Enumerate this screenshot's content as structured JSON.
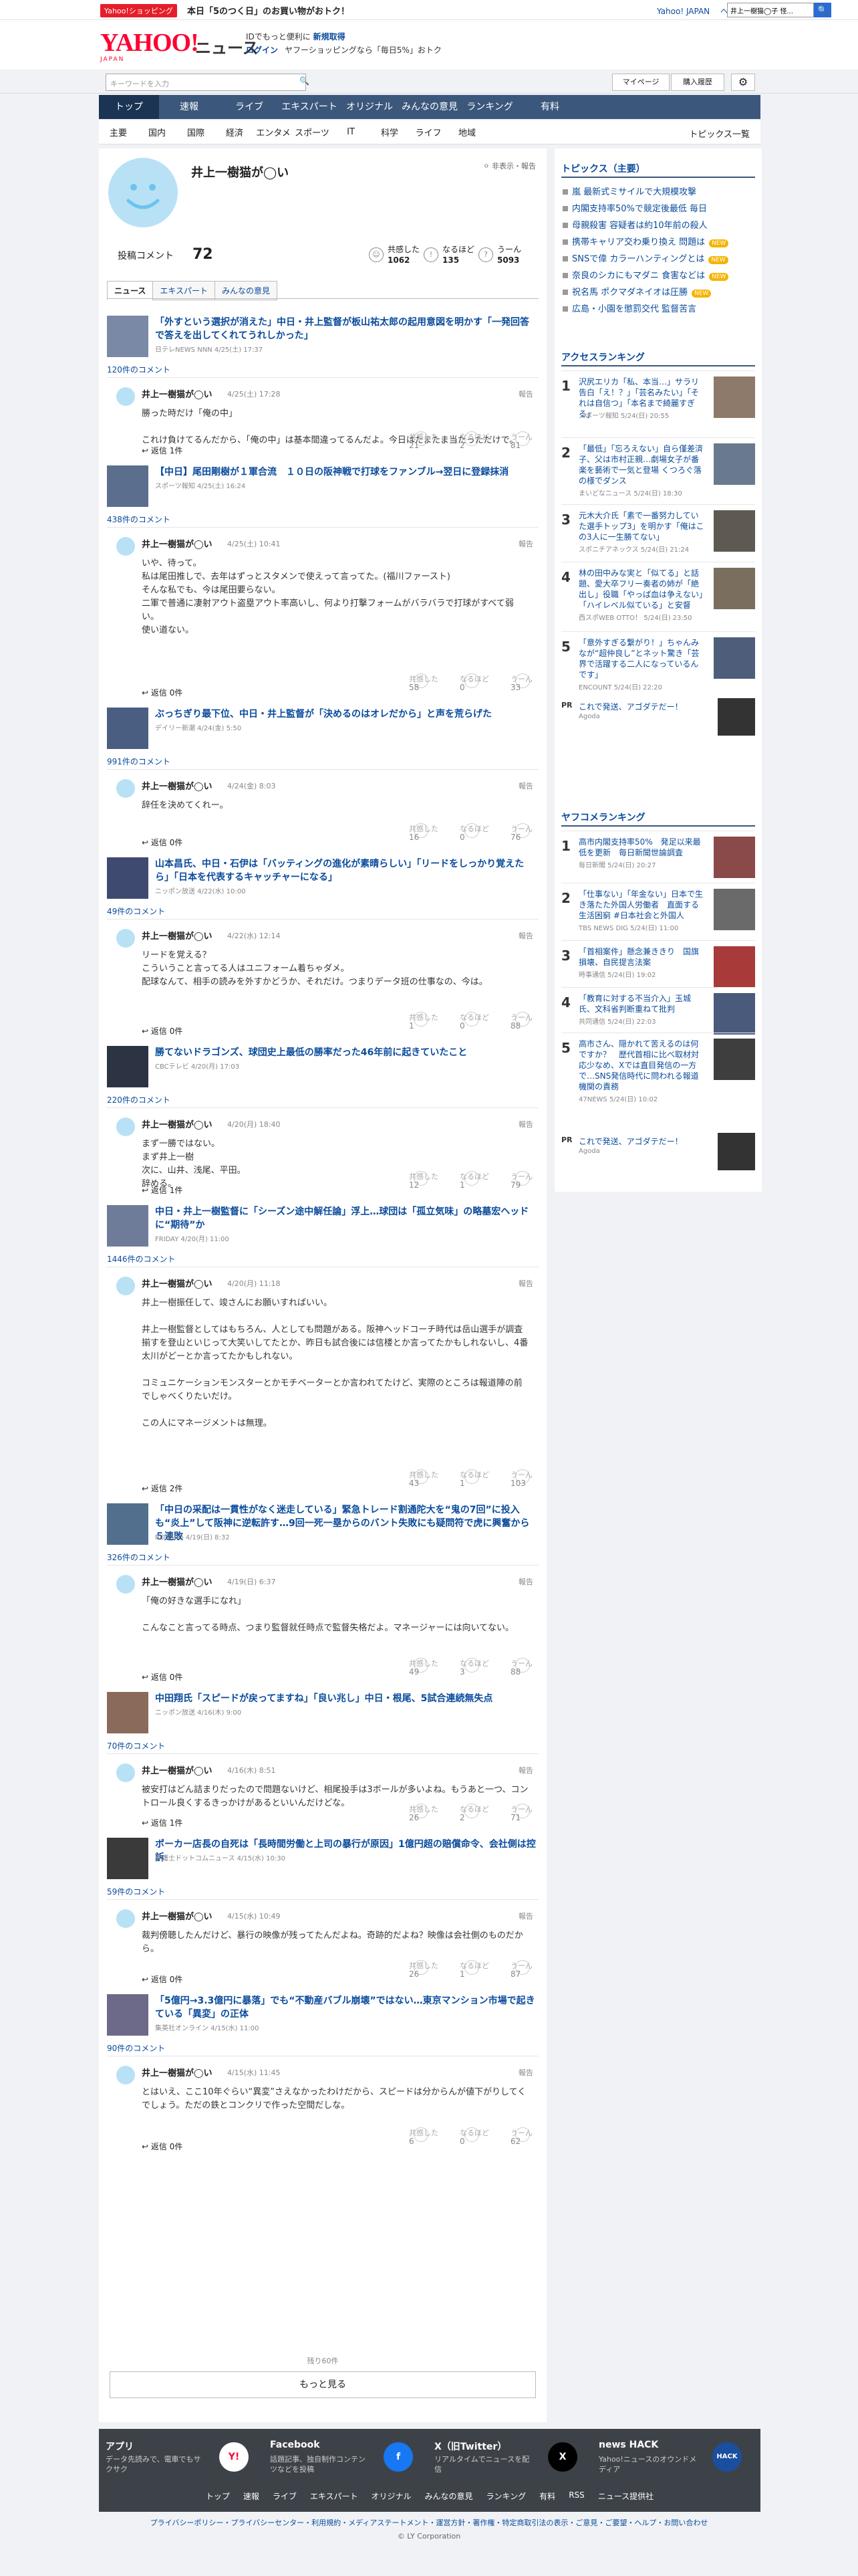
{
  "topbar": {
    "promo_badge": "Yahoo!ショッピング",
    "promo_text": "本日「5のつく日」のお買い物がおトク！",
    "links": [
      "Yahoo! JAPAN",
      "ヘルプ"
    ],
    "search_placeholder": "ウェブ検索",
    "search_value": "井上一樹猫◯子 怪..."
  },
  "header": {
    "logo": "YAHOO!",
    "logo_sub": "JAPAN",
    "service": "ニュース",
    "login_note_pre": "IDでもっと便利に",
    "login_note_link": "新規取得",
    "login_link": "ログイン",
    "login_promo": "ヤフーショッピングなら「毎日5%」おトク"
  },
  "searchbar": {
    "placeholder": "キーワードを入力",
    "mypage": "マイページ",
    "history": "購入履歴"
  },
  "nav1": [
    "トップ",
    "速報",
    "ライブ",
    "エキスパート",
    "オリジナル",
    "みんなの意見",
    "ランキング",
    "有料"
  ],
  "nav2": [
    "主要",
    "国内",
    "国際",
    "経済",
    "エンタメ",
    "スポーツ",
    "IT",
    "科学",
    "ライフ",
    "地域"
  ],
  "nav2_all": "トピックス一覧",
  "profile": {
    "name": "井上一樹猫が◯い",
    "private": "非表示・報告",
    "comments_label": "投稿コメント",
    "comments_count": "72",
    "stats": [
      {
        "label": "共感した",
        "value": "1062"
      },
      {
        "label": "なるほど",
        "value": "135"
      },
      {
        "label": "うーん",
        "value": "5093"
      }
    ]
  },
  "tabs": [
    "ニュース",
    "エキスパート",
    "みんなの意見"
  ],
  "user": {
    "name": "井上一樹猫が◯い",
    "report": "報告",
    "r1": "共感した",
    "r2": "なるほど",
    "r3": "うーん"
  },
  "items": [
    {
      "title": "「外すという選択が消えた」中日・井上監督が板山祐太郎の起用意図を明かす「一発回答で答えを出してくれてうれしかった」",
      "meta": "日テレNEWS NNN 4/25(土) 17:37",
      "comments": "120件のコメント",
      "time": "4/25(土) 17:28",
      "body": "勝った時だけ「俺の中」\n\nこれけ負けてるんだから、「俺の中」は基本間違ってるんだよ。今日はたまたま当たっただけで。",
      "reply": "返信 1件",
      "n1": "21",
      "n2": "2",
      "n3": "81"
    },
    {
      "title": "【中日】尾田剛樹が１軍合流　１０日の阪神戦で打球をファンブル→翌日に登録抹消",
      "meta": "スポーツ報知 4/25(土) 16:24",
      "comments": "438件のコメント",
      "time": "4/25(土) 10:41",
      "body": "いや、待って。\n私は尾田推しで、去年はずっとスタメンで使えって言ってた。(福川ファースト)\nそんな私でも、今は尾田要らない。\n二軍で普通に凄射アウト盗塁アウト率高いし、何より打撃フォームがバラバラで打球がすべて弱い。\n使い道ない。",
      "reply": "返信 0件",
      "n1": "58",
      "n2": "0",
      "n3": "33"
    },
    {
      "title": "ぶっちぎり最下位、中日・井上監督が「決めるのはオレだから」と声を荒らげた",
      "meta": "デイリー新潮 4/24(金) 5:50",
      "comments": "991件のコメント",
      "time": "4/24(金) 8:03",
      "body": "辞任を決めてくれー。",
      "reply": "返信 0件",
      "n1": "16",
      "n2": "0",
      "n3": "76"
    },
    {
      "title": "山本昌氏、中日・石伊は「バッティングの進化が素晴らしい」「リードをしっかり覚えたら」「日本を代表するキャッチャーになる」",
      "meta": "ニッポン放送 4/22(水) 10:00",
      "comments": "49件のコメント",
      "time": "4/22(水) 12:14",
      "body": "リードを覚える？\nこういうこと言ってる人はユニフォーム着ちゃダメ。\n配球なんて、相手の読みを外すかどうか、それだけ。つまりデータ班の仕事なの、今は。",
      "reply": "返信 0件",
      "n1": "1",
      "n2": "0",
      "n3": "88"
    },
    {
      "title": "勝てないドラゴンズ、球団史上最低の勝率だった46年前に起きていたこと",
      "meta": "CBCテレビ 4/20(月) 17:03",
      "comments": "220件のコメント",
      "time": "4/20(月) 18:40",
      "body": "まず一勝ではない。\nまず井上一樹\n次に、山井、浅尾、平田。\n辞める。",
      "reply": "返信 1件",
      "n1": "12",
      "n2": "1",
      "n3": "79"
    },
    {
      "title": "中日・井上一樹監督に「シーズン途中解任論」浮上…球団は「孤立気味」の略墓宏ヘッドに“期待”か",
      "meta": "FRIDAY 4/20(月) 11:00",
      "comments": "1446件のコメント",
      "time": "4/20(月) 11:18",
      "body": "井上一樹振任して、竣さんにお願いすればいい。\n\n井上一樹監督としてはもちろん、人としても問題がある。阪神ヘッドコーチ時代は岳山選手が調査揃すを登山といじって大笑いしてたとか、昨日も試合後には信楼とか言ってたかもしれないし、4番太川がどーとか言ってたかもしれない。\n\nコミュニケーションモンスターとかモチベーターとか言われてたけど、実際のところは報道陣の前でしゃべくりたいだけ。\n\nこの人にマネージメントは無理。",
      "reply": "返信 2件",
      "n1": "43",
      "n2": "1",
      "n3": "103"
    },
    {
      "title": "「中日の采配は一貫性がなく迷走している」緊急トレード割通陀大を“鬼の7回”に投入も“炎上”して阪神に逆転許す…9回一死一塁からのバント失敗にも疑問符で虎に興奮から５連敗",
      "meta": "RONSPO 4/19(日) 8:32",
      "comments": "326件のコメント",
      "time": "4/19(日) 6:37",
      "body": "「俺の好きな選手になれ」\n\nこんなこと言ってる時点、つまり監督就任時点で監督失格だよ。マネージャーには向いてない。",
      "reply": "返信 0件",
      "n1": "49",
      "n2": "3",
      "n3": "88"
    },
    {
      "title": "中田翔氏「スピードが戻ってますね」「良い兆し」中日・根尾、5試合連続無失点",
      "meta": "ニッポン放送 4/16(木) 9:00",
      "comments": "70件のコメント",
      "time": "4/16(木) 8:51",
      "body": "被安打はどん詰まりだったので問題ないけど、相尾投手は3ボールが多いよね。もうあと一つ、コントロール良くするきっかけがあるといいんだけどな。",
      "reply": "返信 1件",
      "n1": "26",
      "n2": "2",
      "n3": "71"
    },
    {
      "title": "ポーカー店長の自死は「長時間労働と上司の暴行が原因」1億円超の賠償命令、会社側は控訴",
      "meta": "弁護士ドットコムニュース 4/15(水) 10:30",
      "comments": "59件のコメント",
      "time": "4/15(水) 10:49",
      "body": "裁判傍聴したんだけど、暴行の映像が残ってたんだよね。奇跡的だよね？映像は会社側のものだから。",
      "reply": "返信 0件",
      "n1": "26",
      "n2": "1",
      "n3": "87"
    },
    {
      "title": "「5億円→3.3億円に暴落」でも“不動産バブル崩壊”ではない…東京マンション市場で起きている「異変」の正体",
      "meta": "集英社オンライン 4/15(水) 11:00",
      "comments": "90件のコメント",
      "time": "4/15(水) 11:45",
      "body": "とはいえ、ここ10年ぐらい“異変”さえなかったわけだから、スピードは分からんが値下がりしてくでしょう。ただの鉄とコンクリで作った空間だしな。",
      "reply": "返信 0件",
      "n1": "6",
      "n2": "0",
      "n3": "62"
    }
  ],
  "more": {
    "note": "残り60件",
    "button": "もっと見る"
  },
  "side": {
    "topics_title": "トピックス（主要）",
    "topics": [
      {
        "t": "嵐 最新式ミサイルで大規模攻撃",
        "new": false
      },
      {
        "t": "内閣支持率50%で競定後最低 毎日",
        "new": false
      },
      {
        "t": "母親殺害 容疑者は約10年前の殺人",
        "new": false
      },
      {
        "t": "携帯キャリア交わ乗り換え 問題は",
        "new": true
      },
      {
        "t": "SNSで偉 カラーハンティングとは",
        "new": true
      },
      {
        "t": "奈良のシカにもマダニ 食害などは",
        "new": true
      },
      {
        "t": "祝名馬 ポクマダネイオは圧勝",
        "new": true
      },
      {
        "t": "広島・小園を懲罰交代 監督苦言",
        "new": false
      }
    ],
    "access_title": "アクセスランキング",
    "access": [
      {
        "n": "1",
        "t": "沢尻エリカ「私、本当…」サラリ告白「え！？」「芸名みたい」「それは自信つ」「本名まで綺麗すぎる」",
        "s": "スポーツ報知 5/24(日) 20:55"
      },
      {
        "n": "2",
        "t": "「最低」「忘ろえない」自ら僅差済子、父は市村正親…劇場女子が番楽を藝術で一気と登場 くつろぐ落の様でダンス",
        "s": "まいどなニュース 5/24(日) 18:30"
      },
      {
        "n": "3",
        "t": "元木大介氏「素で一番努力していた選手トップ3」を明かす「俺はこの3人に一生勝てない」",
        "s": "スポニチアネックス 5/24(日) 21:24"
      },
      {
        "n": "4",
        "t": "林の田中みな実と「似てる」と話題、愛大卒フリー奏者の姉が「絶出し」役職「やっぱ血は争えない」「ハイレベル似ている」と安督",
        "s": "西スポWEB OTTO！ 5/24(日) 23:50"
      },
      {
        "n": "5",
        "t": "「意外すぎる繋がり！」ちゃんみなが“超仲良し”とネット驚き「芸界で活躍する二人になっているんです」",
        "s": "ENCOUNT 5/24(日) 22:20"
      }
    ],
    "pr": {
      "tag": "PR",
      "title": "これで発送、アゴダテだー！",
      "src": "Agoda"
    },
    "yafoco_title": "ヤフコメランキング",
    "yafoco": [
      {
        "n": "1",
        "t": "高市内閣支持率50%　発足以来最低を更新　毎日新聞世論調査",
        "s": "毎日新聞 5/24(日) 20:27"
      },
      {
        "n": "2",
        "t": "「仕事ない」「年金ない」日本で生き落たた外国人労働者　直面する生活困窮 #日本社会と外国人",
        "s": "TBS NEWS DIG 5/24(日) 11:00"
      },
      {
        "n": "3",
        "t": "「首相案件」懸念兼ききり　国旗損壊、自民提言法案",
        "s": "時事通信 5/24(日) 19:02"
      },
      {
        "n": "4",
        "t": "「教育に対する不当介入」玉城氏、文科省判断重ねて批判",
        "s": "共同通信 5/24(日) 22:03"
      },
      {
        "n": "5",
        "t": "高市さん、隠かれて苦えるのは何ですか？　歴代首相に比べ取材対応少なめ、Xでは直目発信の一方で…SNS発信時代に問われる報道機関の責務",
        "s": "47NEWS 5/24(日) 10:02"
      }
    ],
    "pr2": {
      "tag": "PR",
      "title": "これで発送、アゴダテだー！",
      "src": "Agoda"
    }
  },
  "footer": {
    "apps": [
      {
        "t": "アプリ",
        "d": "データ先読みで、電車でもサクサク",
        "ic": "Y!"
      },
      {
        "t": "Facebook",
        "d": "話題記事、独自制作コンテンツなどを投稿",
        "ic": "f"
      },
      {
        "t": "X（旧Twitter）",
        "d": "リアルタイムでニュースを配信",
        "ic": "X"
      },
      {
        "t": "news HACK",
        "d": "Yahoo!ニュースのオウンドメディア",
        "ic": "HACK"
      }
    ],
    "nav": [
      "トップ",
      "速報",
      "ライブ",
      "エキスパート",
      "オリジナル",
      "みんなの意見",
      "ランキング",
      "有料",
      "RSS",
      "ニュース提供社"
    ],
    "legal": "プライバシーポリシー・プライバシーセンター・利用規約・メディアステートメント・運営方針・著作権・特定商取引法の表示・ご意見・ご要望・ヘルプ・お問い合わせ",
    "copy": "© LY Corporation"
  }
}
